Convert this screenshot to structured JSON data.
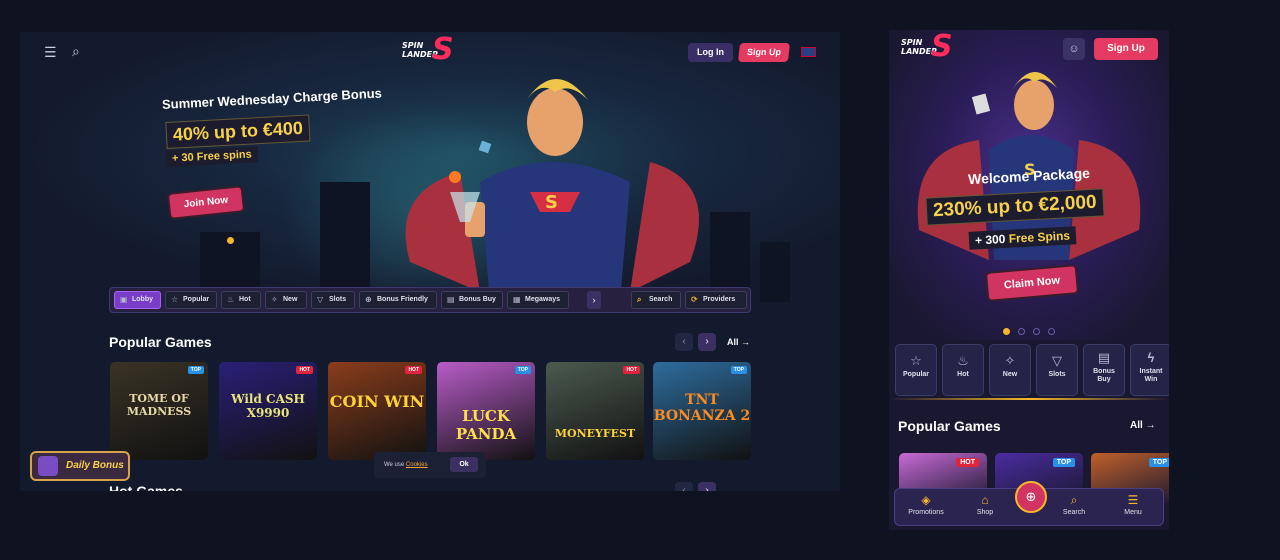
{
  "desktop": {
    "logo": {
      "line1": "SPIN",
      "line2": "LANDER",
      "mark": "S"
    },
    "header": {
      "menu_icon": "menu-icon",
      "search_icon": "search-icon",
      "login": "Log In",
      "signup": "Sign Up",
      "flag": "uk-flag-icon"
    },
    "promo": {
      "title": "Summer Wednesday Charge Bonus",
      "amount": "40% up to €400",
      "free": "+ 30 Free spins",
      "cta": "Join Now"
    },
    "categories": [
      {
        "label": "Lobby",
        "icon": "lobby-icon",
        "glyph": "▣"
      },
      {
        "label": "Popular",
        "icon": "star-icon",
        "glyph": "☆"
      },
      {
        "label": "Hot",
        "icon": "flame-icon",
        "glyph": "♨"
      },
      {
        "label": "New",
        "icon": "sparkle-icon",
        "glyph": "✧"
      },
      {
        "label": "Slots",
        "icon": "slots-icon",
        "glyph": "▽"
      },
      {
        "label": "Bonus Friendly",
        "icon": "bonus-icon",
        "glyph": "⊕"
      },
      {
        "label": "Bonus Buy",
        "icon": "gift-icon",
        "glyph": "▤"
      },
      {
        "label": "Megaways",
        "icon": "megaways-icon",
        "glyph": "▦"
      }
    ],
    "search": "Search",
    "providers": "Providers",
    "popular": {
      "title": "Popular Games",
      "all": "All →",
      "games": [
        {
          "name": "TOME OF MADNESS",
          "tag": "TOP",
          "bg": "#3a3326",
          "fg": "#e8d9a8"
        },
        {
          "name": "Wild CASH X9990",
          "tag": "HOT",
          "bg": "#2a1f78",
          "fg": "#e9e57a"
        },
        {
          "name": "COIN WIN",
          "tag": "HOT",
          "bg": "#8a3d1b",
          "fg": "#ffd23a"
        },
        {
          "name": "LUCK PANDA",
          "tag": "TOP",
          "bg": "#b85cc9",
          "fg": "#ffe04a"
        },
        {
          "name": "MONEYFEST",
          "tag": "HOT",
          "bg": "#4b5a4f",
          "fg": "#ffd23a"
        },
        {
          "name": "TNT BONANZA 2",
          "tag": "TOP",
          "bg": "#2e6d9e",
          "fg": "#ff8a1e"
        }
      ]
    },
    "daily_bonus": "Daily Bonus",
    "cookie": {
      "text": "We use",
      "link": "Cookies",
      "ok": "Ok"
    },
    "hot_games_title": "Hot Games"
  },
  "mobile": {
    "signup": "Sign Up",
    "promo": {
      "title": "Welcome Package",
      "amount": "230% up to €2,000",
      "free_prefix": "+ 300",
      "free_suffix": "Free Spins",
      "cta": "Claim Now"
    },
    "categories": [
      {
        "label": "Popular",
        "glyph": "☆"
      },
      {
        "label": "Hot",
        "glyph": "♨"
      },
      {
        "label": "New",
        "glyph": "✧"
      },
      {
        "label": "Slots",
        "glyph": "▽"
      },
      {
        "label": "Bonus Buy",
        "glyph": "▤"
      },
      {
        "label": "Instant Win",
        "glyph": "ϟ"
      }
    ],
    "popular": {
      "title": "Popular Games",
      "all": "All →"
    },
    "cards": [
      {
        "tag": "HOT",
        "bg": "#c86bd6"
      },
      {
        "tag": "TOP",
        "bg": "#4a2ca0"
      },
      {
        "tag": "TOP",
        "bg": "#c0602a"
      }
    ],
    "bottom_nav": [
      {
        "label": "Promotions",
        "glyph": "◈"
      },
      {
        "label": "Shop",
        "glyph": "⌂"
      },
      {
        "label": "Search",
        "glyph": "⌕"
      },
      {
        "label": "Menu",
        "glyph": "☰"
      }
    ],
    "center_icon": "lock-icon"
  }
}
